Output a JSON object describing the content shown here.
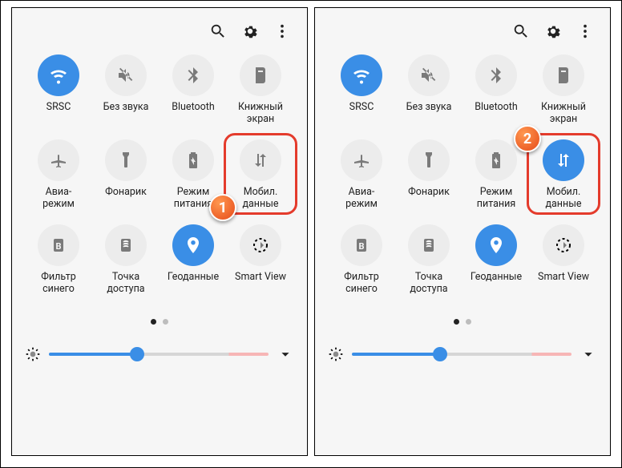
{
  "panels": [
    {
      "tiles": [
        {
          "label": "SRSC",
          "icon": "wifi",
          "on": true
        },
        {
          "label": "Без звука",
          "icon": "mute",
          "on": false
        },
        {
          "label": "Bluetooth",
          "icon": "bluetooth",
          "on": false
        },
        {
          "label": "Книжный\nэкран",
          "icon": "book",
          "on": false
        },
        {
          "label": "Авиа-\nрежим",
          "icon": "plane",
          "on": false
        },
        {
          "label": "Фонарик",
          "icon": "torch",
          "on": false
        },
        {
          "label": "Режим\nпитания",
          "icon": "battery",
          "on": false
        },
        {
          "label": "Мобил.\nданные",
          "icon": "data",
          "on": false,
          "highlight": true,
          "badge": "1"
        },
        {
          "label": "Фильтр\nсинего",
          "icon": "blue",
          "on": false
        },
        {
          "label": "Точка\nдоступа",
          "icon": "hotspot",
          "on": false
        },
        {
          "label": "Геоданные",
          "icon": "location",
          "on": true
        },
        {
          "label": "Smart View",
          "icon": "smartview",
          "on": false
        }
      ]
    },
    {
      "tiles": [
        {
          "label": "SRSC",
          "icon": "wifi",
          "on": true
        },
        {
          "label": "Без звука",
          "icon": "mute",
          "on": false
        },
        {
          "label": "Bluetooth",
          "icon": "bluetooth",
          "on": false
        },
        {
          "label": "Книжный\nэкран",
          "icon": "book",
          "on": false
        },
        {
          "label": "Авиа-\nрежим",
          "icon": "plane",
          "on": false
        },
        {
          "label": "Фонарик",
          "icon": "torch",
          "on": false
        },
        {
          "label": "Режим\nпитания",
          "icon": "battery",
          "on": false
        },
        {
          "label": "Мобил.\nданные",
          "icon": "data",
          "on": true,
          "highlight": true,
          "badge": "2",
          "badgeTop": true
        },
        {
          "label": "Фильтр\nсинего",
          "icon": "blue",
          "on": false
        },
        {
          "label": "Точка\nдоступа",
          "icon": "hotspot",
          "on": false
        },
        {
          "label": "Геоданные",
          "icon": "location",
          "on": true
        },
        {
          "label": "Smart View",
          "icon": "smartview",
          "on": false
        }
      ]
    }
  ],
  "pager": {
    "pages": 2,
    "active": 0
  },
  "brightness": {
    "percent": 40
  }
}
